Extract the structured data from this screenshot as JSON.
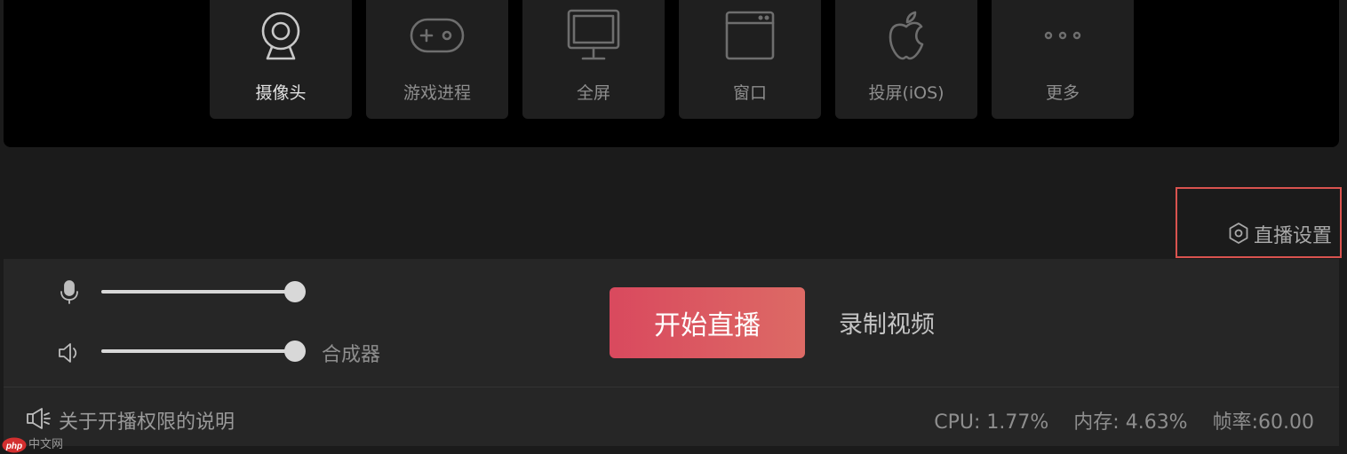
{
  "sources": [
    {
      "label": "摄像头",
      "icon": "webcam-icon",
      "active": true
    },
    {
      "label": "游戏进程",
      "icon": "gamepad-icon",
      "active": false
    },
    {
      "label": "全屏",
      "icon": "monitor-icon",
      "active": false
    },
    {
      "label": "窗口",
      "icon": "window-icon",
      "active": false
    },
    {
      "label": "投屏(iOS)",
      "icon": "apple-icon",
      "active": false
    },
    {
      "label": "更多",
      "icon": "more-icon",
      "active": false
    }
  ],
  "live_settings": {
    "label": "直播设置",
    "icon": "settings-hexagon-icon"
  },
  "audio": {
    "mic": {
      "icon": "microphone-icon",
      "level": 1.0
    },
    "speaker": {
      "icon": "speaker-icon",
      "level": 1.0
    },
    "mixer_label": "合成器"
  },
  "actions": {
    "start_live": "开始直播",
    "record_video": "录制视频"
  },
  "status": {
    "notice_icon": "megaphone-icon",
    "notice_text": "关于开播权限的说明",
    "cpu": "CPU: 1.77%",
    "memory": "内存: 4.63%",
    "fps": "帧率:60.00"
  },
  "watermark": {
    "logo_text": "php",
    "text": "中文网"
  },
  "colors": {
    "accent_start": "#d9495e",
    "accent_end": "#dd6a65",
    "highlight_border": "#d9534f",
    "panel_bg": "#262626",
    "source_panel_bg": "#000000"
  }
}
